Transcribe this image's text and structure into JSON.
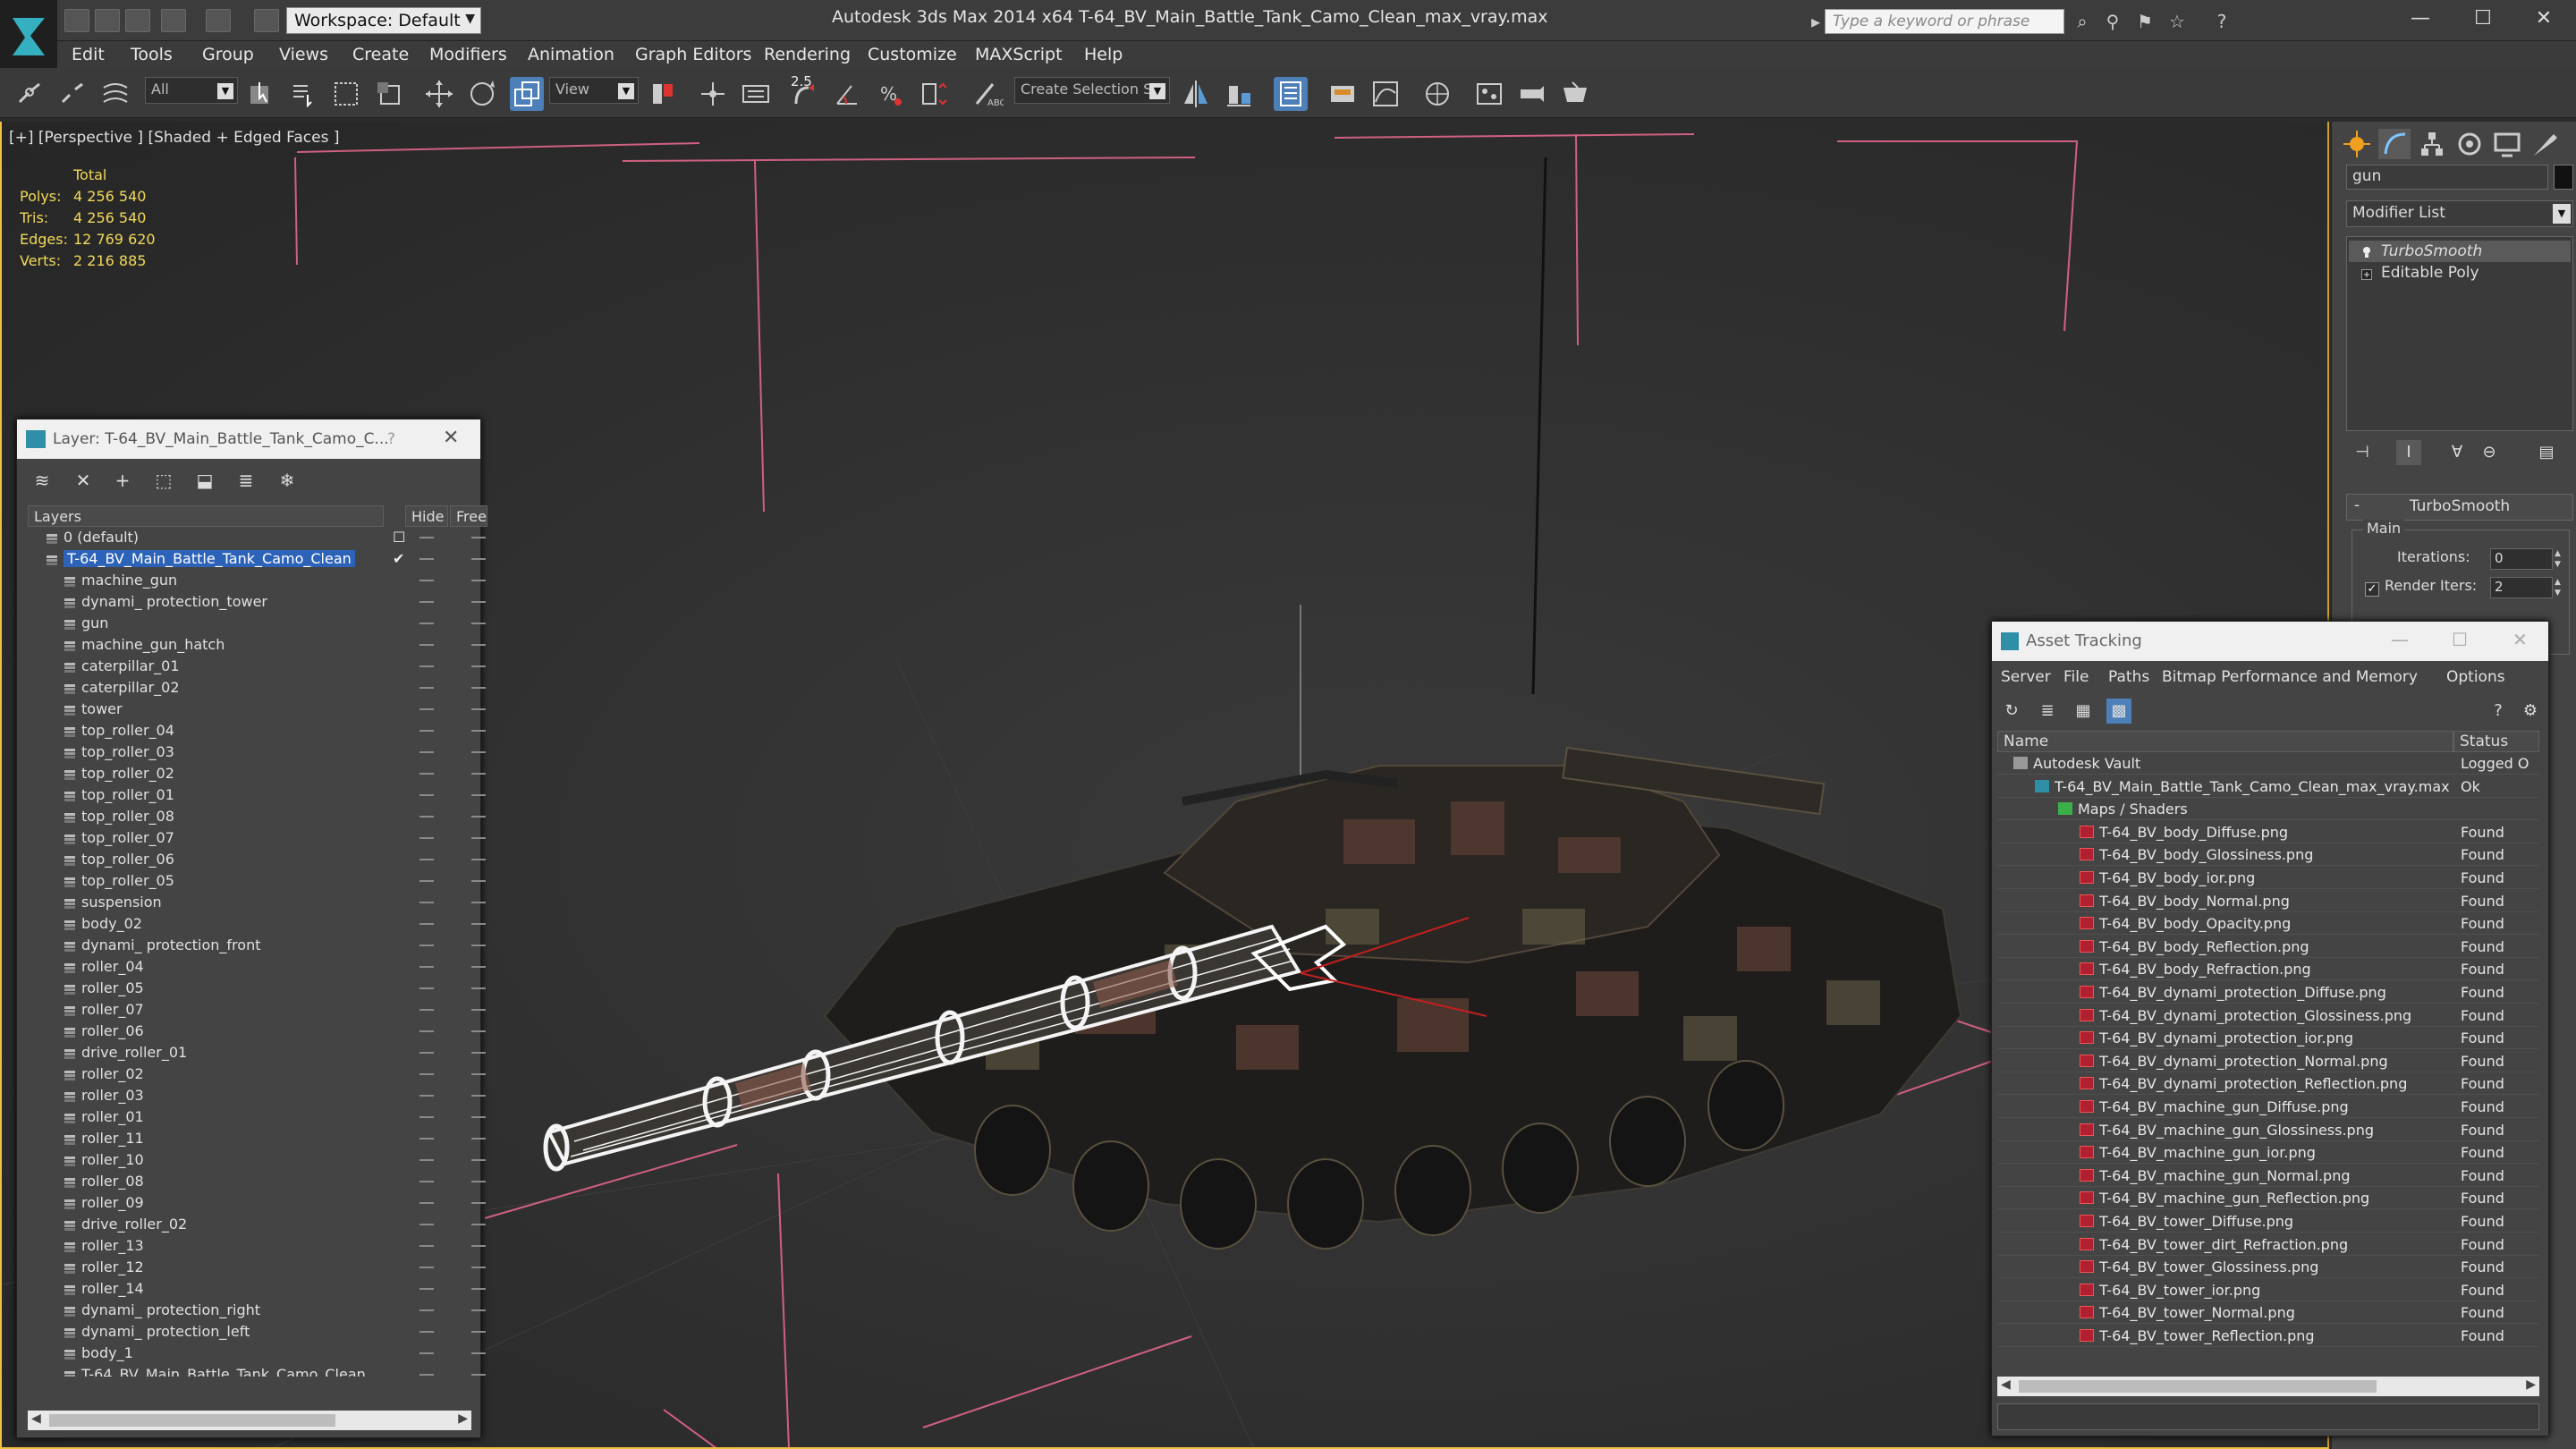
{
  "title_bar": {
    "workspace": "Workspace: Default",
    "title": "Autodesk 3ds Max  2014 x64      T-64_BV_Main_Battle_Tank_Camo_Clean_max_vray.max",
    "search_placeholder": "Type a keyword or phrase"
  },
  "menu": [
    "Edit",
    "Tools",
    "Group",
    "Views",
    "Create",
    "Modifiers",
    "Animation",
    "Graph Editors",
    "Rendering",
    "Customize",
    "MAXScript",
    "Help"
  ],
  "toolbar": {
    "filter": "All",
    "refcoord": "View",
    "snap_label": "2.5",
    "selection_set": "Create Selection Se"
  },
  "viewport": {
    "label": "[+] [Perspective ] [Shaded + Edged Faces ]",
    "stats_header": "Total",
    "stats": [
      {
        "label": "Polys:",
        "value": "4 256 540"
      },
      {
        "label": "Tris:",
        "value": "4 256 540"
      },
      {
        "label": "Edges:",
        "value": "12 769 620"
      },
      {
        "label": "Verts:",
        "value": "2 216 885"
      }
    ]
  },
  "command_panel": {
    "object_name": "gun",
    "modifier_list": "Modifier List",
    "stack": [
      "TurboSmooth",
      "Editable Poly"
    ],
    "rollout": "TurboSmooth",
    "group": "Main",
    "iterations_label": "Iterations:",
    "iterations": "0",
    "render_iters_label": "Render Iters:",
    "render_iters": "2"
  },
  "layer_panel": {
    "title": "Layer: T-64_BV_Main_Battle_Tank_Camo_C...",
    "help": "?",
    "columns": [
      "Layers",
      "Hide",
      "Free"
    ],
    "layers": [
      {
        "name": "0 (default)",
        "level": 0
      },
      {
        "name": "T-64_BV_Main_Battle_Tank_Camo_Clean",
        "level": 0,
        "selected": true
      },
      {
        "name": "machine_gun",
        "level": 1
      },
      {
        "name": "dynami_ protection_tower",
        "level": 1
      },
      {
        "name": "gun",
        "level": 1
      },
      {
        "name": "machine_gun_hatch",
        "level": 1
      },
      {
        "name": "caterpillar_01",
        "level": 1
      },
      {
        "name": "caterpillar_02",
        "level": 1
      },
      {
        "name": "tower",
        "level": 1
      },
      {
        "name": "top_roller_04",
        "level": 1
      },
      {
        "name": "top_roller_03",
        "level": 1
      },
      {
        "name": "top_roller_02",
        "level": 1
      },
      {
        "name": "top_roller_01",
        "level": 1
      },
      {
        "name": "top_roller_08",
        "level": 1
      },
      {
        "name": "top_roller_07",
        "level": 1
      },
      {
        "name": "top_roller_06",
        "level": 1
      },
      {
        "name": "top_roller_05",
        "level": 1
      },
      {
        "name": "suspension",
        "level": 1
      },
      {
        "name": "body_02",
        "level": 1
      },
      {
        "name": "dynami_ protection_front",
        "level": 1
      },
      {
        "name": "roller_04",
        "level": 1
      },
      {
        "name": "roller_05",
        "level": 1
      },
      {
        "name": "roller_07",
        "level": 1
      },
      {
        "name": "roller_06",
        "level": 1
      },
      {
        "name": "drive_roller_01",
        "level": 1
      },
      {
        "name": "roller_02",
        "level": 1
      },
      {
        "name": "roller_03",
        "level": 1
      },
      {
        "name": "roller_01",
        "level": 1
      },
      {
        "name": "roller_11",
        "level": 1
      },
      {
        "name": "roller_10",
        "level": 1
      },
      {
        "name": "roller_08",
        "level": 1
      },
      {
        "name": "roller_09",
        "level": 1
      },
      {
        "name": "drive_roller_02",
        "level": 1
      },
      {
        "name": "roller_13",
        "level": 1
      },
      {
        "name": "roller_12",
        "level": 1
      },
      {
        "name": "roller_14",
        "level": 1
      },
      {
        "name": "dynami_ protection_right",
        "level": 1
      },
      {
        "name": "dynami_ protection_left",
        "level": 1
      },
      {
        "name": "body_1",
        "level": 1
      },
      {
        "name": "T-64_BV_Main_Battle_Tank_Camo_Clean",
        "level": 1
      }
    ]
  },
  "asset_panel": {
    "title": "Asset Tracking",
    "menu": [
      "Server",
      "File",
      "Paths",
      "Bitmap Performance and Memory",
      "Options"
    ],
    "columns": [
      "Name",
      "Status"
    ],
    "rows": [
      {
        "name": "Autodesk Vault",
        "status": "Logged O",
        "level": 0,
        "icon": "vault"
      },
      {
        "name": "T-64_BV_Main_Battle_Tank_Camo_Clean_max_vray.max",
        "status": "Ok",
        "level": 1,
        "icon": "max"
      },
      {
        "name": "Maps / Shaders",
        "status": "",
        "level": 2,
        "icon": "folder"
      },
      {
        "name": "T-64_BV_body_Diffuse.png",
        "status": "Found",
        "level": 3,
        "icon": "png"
      },
      {
        "name": "T-64_BV_body_Glossiness.png",
        "status": "Found",
        "level": 3,
        "icon": "png"
      },
      {
        "name": "T-64_BV_body_ior.png",
        "status": "Found",
        "level": 3,
        "icon": "png"
      },
      {
        "name": "T-64_BV_body_Normal.png",
        "status": "Found",
        "level": 3,
        "icon": "png"
      },
      {
        "name": "T-64_BV_body_Opacity.png",
        "status": "Found",
        "level": 3,
        "icon": "png"
      },
      {
        "name": "T-64_BV_body_Reflection.png",
        "status": "Found",
        "level": 3,
        "icon": "png"
      },
      {
        "name": "T-64_BV_body_Refraction.png",
        "status": "Found",
        "level": 3,
        "icon": "png"
      },
      {
        "name": "T-64_BV_dynami_protection_Diffuse.png",
        "status": "Found",
        "level": 3,
        "icon": "png"
      },
      {
        "name": "T-64_BV_dynami_protection_Glossiness.png",
        "status": "Found",
        "level": 3,
        "icon": "png"
      },
      {
        "name": "T-64_BV_dynami_protection_ior.png",
        "status": "Found",
        "level": 3,
        "icon": "png"
      },
      {
        "name": "T-64_BV_dynami_protection_Normal.png",
        "status": "Found",
        "level": 3,
        "icon": "png"
      },
      {
        "name": "T-64_BV_dynami_protection_Reflection.png",
        "status": "Found",
        "level": 3,
        "icon": "png"
      },
      {
        "name": "T-64_BV_machine_gun_Diffuse.png",
        "status": "Found",
        "level": 3,
        "icon": "png"
      },
      {
        "name": "T-64_BV_machine_gun_Glossiness.png",
        "status": "Found",
        "level": 3,
        "icon": "png"
      },
      {
        "name": "T-64_BV_machine_gun_ior.png",
        "status": "Found",
        "level": 3,
        "icon": "png"
      },
      {
        "name": "T-64_BV_machine_gun_Normal.png",
        "status": "Found",
        "level": 3,
        "icon": "png"
      },
      {
        "name": "T-64_BV_machine_gun_Reflection.png",
        "status": "Found",
        "level": 3,
        "icon": "png"
      },
      {
        "name": "T-64_BV_tower_Diffuse.png",
        "status": "Found",
        "level": 3,
        "icon": "png"
      },
      {
        "name": "T-64_BV_tower_dirt_Refraction.png",
        "status": "Found",
        "level": 3,
        "icon": "png"
      },
      {
        "name": "T-64_BV_tower_Glossiness.png",
        "status": "Found",
        "level": 3,
        "icon": "png"
      },
      {
        "name": "T-64_BV_tower_ior.png",
        "status": "Found",
        "level": 3,
        "icon": "png"
      },
      {
        "name": "T-64_BV_tower_Normal.png",
        "status": "Found",
        "level": 3,
        "icon": "png"
      },
      {
        "name": "T-64_BV_tower_Reflection.png",
        "status": "Found",
        "level": 3,
        "icon": "png"
      }
    ]
  },
  "colors": {
    "accent": "#4d7fb8",
    "stats_text": "#f1d95a",
    "light_helper": "#d06080",
    "selection": "#2c63b8"
  }
}
